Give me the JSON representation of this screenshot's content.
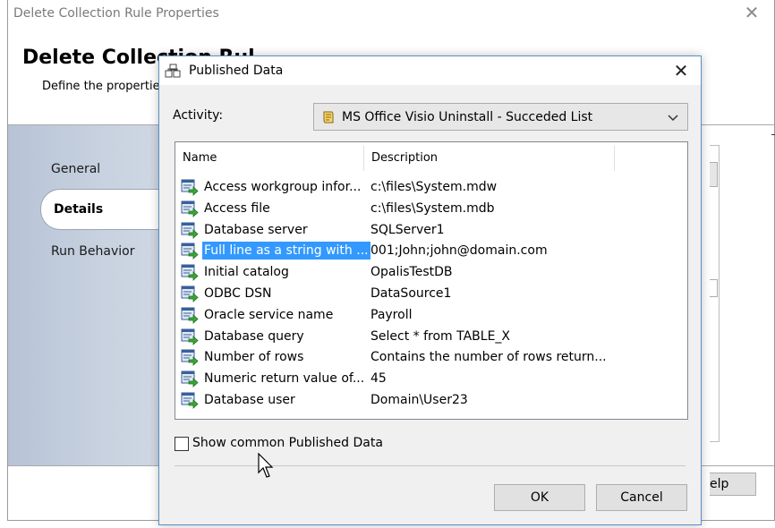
{
  "background_window": {
    "title": "Delete Collection Rule Properties",
    "heading": "Delete Collection Rul",
    "subtitle": "Define the properties",
    "nav_items": [
      "General",
      "Details",
      "Run Behavior"
    ],
    "help_label": "elp"
  },
  "dialog": {
    "title": "Published Data",
    "activity_label": "Activity:",
    "activity_value": "MS Office Visio Uninstall - Succeded List",
    "columns": {
      "name": "Name",
      "description": "Description"
    },
    "rows": [
      {
        "name": "Access workgroup infor...",
        "description": "c:\\files\\System.mdw",
        "selected": false
      },
      {
        "name": "Access file",
        "description": "c:\\files\\System.mdb",
        "selected": false
      },
      {
        "name": "Database server",
        "description": "SQLServer1",
        "selected": false
      },
      {
        "name": "Full line as a string with ...",
        "description": "001;John;john@domain.com",
        "selected": true
      },
      {
        "name": "Initial catalog",
        "description": "OpalisTestDB",
        "selected": false
      },
      {
        "name": "ODBC DSN",
        "description": "DataSource1",
        "selected": false
      },
      {
        "name": "Oracle service name",
        "description": "Payroll",
        "selected": false
      },
      {
        "name": "Database query",
        "description": "Select * from TABLE_X",
        "selected": false
      },
      {
        "name": "Number of rows",
        "description": "Contains the number of rows return...",
        "selected": false
      },
      {
        "name": "Numeric return value of...",
        "description": "45",
        "selected": false
      },
      {
        "name": "Database user",
        "description": "Domain\\User23",
        "selected": false
      }
    ],
    "show_common_label": "Show common Published Data",
    "ok_label": "OK",
    "cancel_label": "Cancel"
  },
  "colors": {
    "selection": "#3399ff",
    "dialog_border": "#5a8ec9",
    "nav_panel": "#c2cddb"
  }
}
